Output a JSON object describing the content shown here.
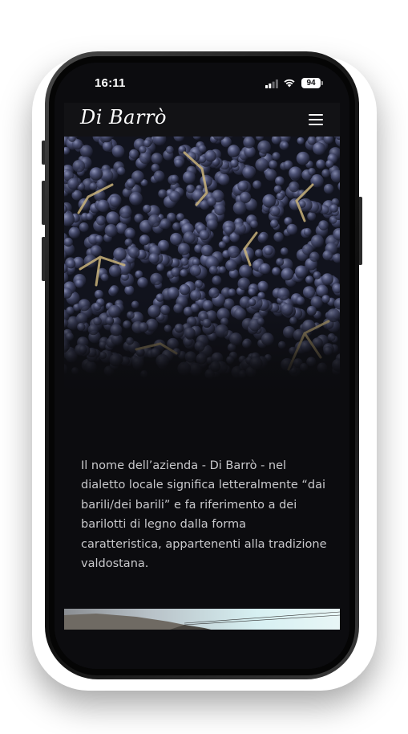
{
  "status_bar": {
    "time": "16:11",
    "battery_level": "94",
    "icons": [
      "signal-icon",
      "wifi-icon",
      "battery-icon"
    ]
  },
  "header": {
    "logo_text": "Di Barrò",
    "menu_icon": "hamburger-menu-icon"
  },
  "hero": {
    "image_subject": "grape-bunches"
  },
  "intro": {
    "text": "Il nome dell’azienda - Di Barrò - nel dialetto locale significa letteralmente “dai barili/dei barili” e fa riferimento a dei barilotti di legno dalla forma caratteristica, appartenenti alla tradizione valdostana."
  },
  "colors": {
    "background": "#0c0c0f",
    "header": "#121215",
    "text": "#c9c9cc",
    "logo": "#ffffff"
  }
}
